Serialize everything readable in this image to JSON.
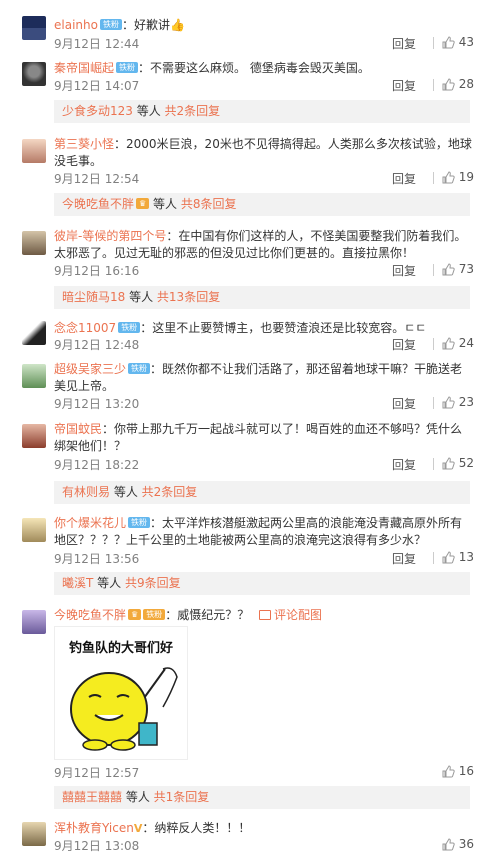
{
  "top_snippet": "...",
  "c1": {
    "user": "elainho",
    "badge": "铁粉",
    "text": "：好歉讲👍",
    "time": "9月12日 12:44",
    "reply": "回复",
    "likes": "43"
  },
  "c2": {
    "user": "秦帝国崛起",
    "badge": "铁粉",
    "text": "：不需要这么麻烦。  德堡病毒会毁灭美国。",
    "time": "9月12日 14:07",
    "reply": "回复",
    "likes": "28"
  },
  "s2": {
    "who": "少食多动123",
    "mid": " 等人 ",
    "cnt": "共2条回复"
  },
  "c3": {
    "user": "第三葵小怪",
    "text": "：2000米巨浪，20米也不见得搞得起。人类那么多次核试验，地球没毛事。",
    "time": "9月12日 12:54",
    "reply": "回复",
    "likes": "19"
  },
  "s3": {
    "who": "今晚吃鱼不胖",
    "mid": " 等人 ",
    "cnt": "共8条回复"
  },
  "c4": {
    "user": "彼岸-等候的第四个号",
    "text": "：在中国有你们这样的人，不怪美国要整我们防着我们。太邪恶了。见过无耻的邪恶的但没见过比你们更甚的。直接拉黑你！",
    "time": "9月12日 16:16",
    "reply": "回复",
    "likes": "73"
  },
  "s4": {
    "who": "暗尘随马18",
    "mid": " 等人 ",
    "cnt": "共13条回复"
  },
  "c5": {
    "user": "念念11007",
    "badge": "铁粉",
    "text": "：这里不止要赞博主，也要赞渣浪还是比较宽容。ㄷㄷ",
    "time": "9月12日 12:48",
    "reply": "回复",
    "likes": "24"
  },
  "c6": {
    "user": "超级吴家三少",
    "badge": "铁粉",
    "text": "：既然你都不让我们活路了，那还留着地球干嘛？干脆送老美见上帝。",
    "time": "9月12日 13:20",
    "reply": "回复",
    "likes": "23"
  },
  "c7": {
    "user": "帝国蚊民",
    "text": "：你带上那九千万一起战斗就可以了！喝百姓的血还不够吗？凭什么绑架他们！？",
    "time": "9月12日 18:22",
    "reply": "回复",
    "likes": "52"
  },
  "s7": {
    "who": "有林则易",
    "mid": " 等人 ",
    "cnt": "共2条回复"
  },
  "c8": {
    "user": "你个爆米花儿",
    "badge": "铁粉",
    "text": "：太平洋炸核潜艇激起两公里高的浪能淹没青藏高原外所有地区？？？？上千公里的土地能被两公里高的浪淹完这浪得有多少水？",
    "time": "9月12日 13:56",
    "reply": "回复",
    "likes": "13"
  },
  "s8": {
    "who": "曦溪T",
    "mid": " 等人 ",
    "cnt": "共9条回复"
  },
  "c9": {
    "user": "今晚吃鱼不胖",
    "badge": "铁粉",
    "text": "：威慑纪元？？",
    "pic_link": "评论配图",
    "meme_caption": "钓鱼队的大哥们好",
    "time": "9月12日 12:57",
    "likes": "16"
  },
  "s9": {
    "who": "囍囍王囍囍",
    "mid": " 等人 ",
    "cnt": "共1条回复"
  },
  "c10": {
    "user": "浑朴教育Yicen",
    "text": "：纳粹反人类！！！",
    "time": "9月12日 13:08",
    "likes": "36"
  }
}
